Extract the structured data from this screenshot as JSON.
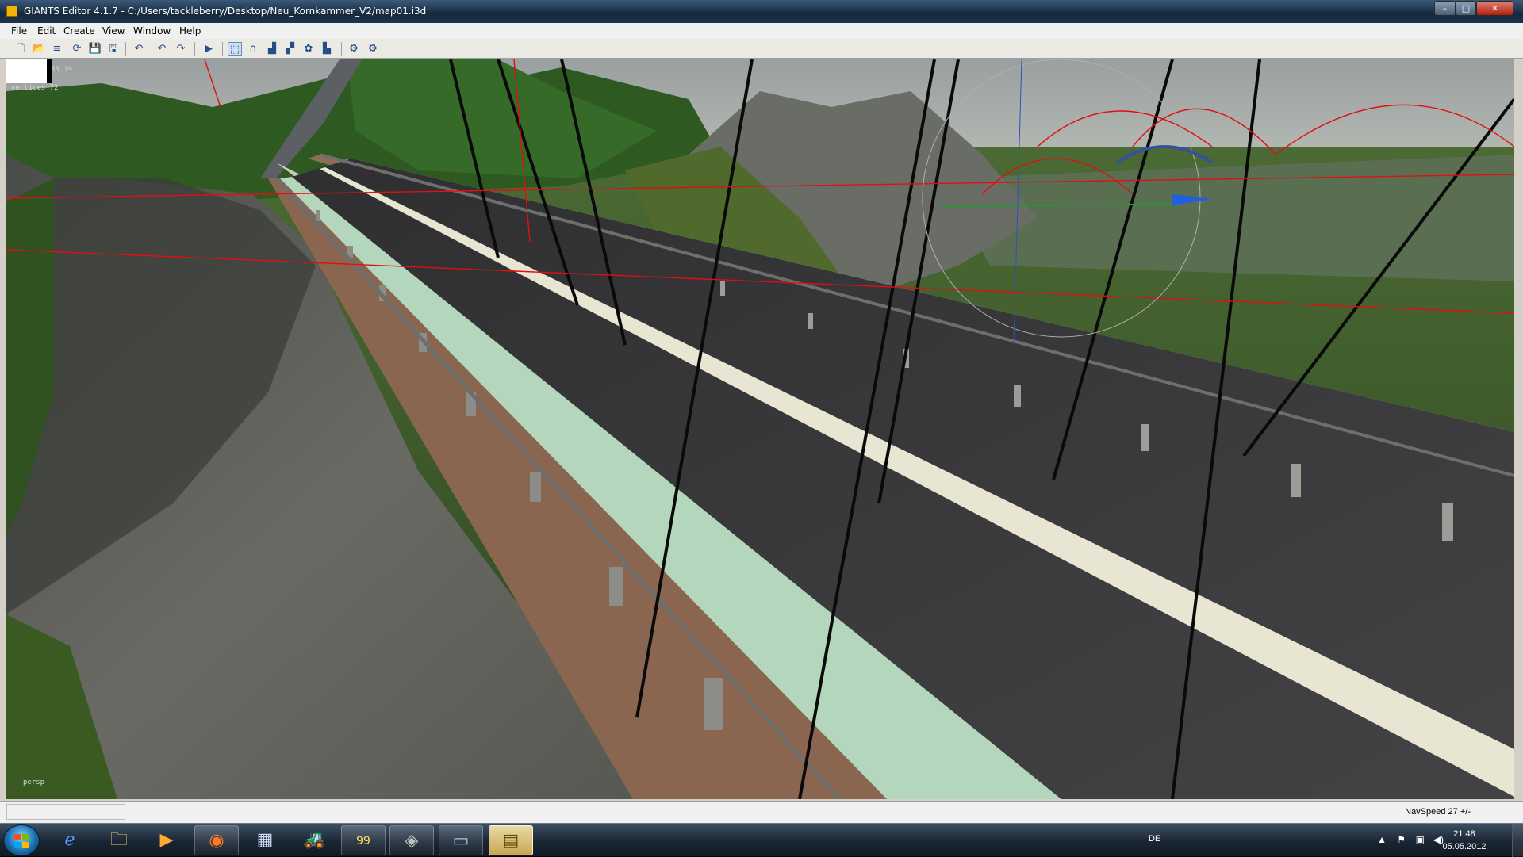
{
  "window": {
    "title": "GIANTS Editor 4.1.7 - C:/Users/tackleberry/Desktop/Neu_Kornkammer_V2/map01.i3d",
    "controls": {
      "minimize": "–",
      "maximize": "□",
      "close": "✕"
    }
  },
  "menu": {
    "items": [
      "File",
      "Edit",
      "Create",
      "View",
      "Window",
      "Help"
    ]
  },
  "toolbar": {
    "buttons": [
      {
        "icon": "new-icon",
        "glyph": "🗋"
      },
      {
        "icon": "open-icon",
        "glyph": "📂"
      },
      {
        "icon": "list-icon",
        "glyph": "≡"
      },
      {
        "icon": "reload-icon",
        "glyph": "⟳"
      },
      {
        "icon": "save-icon",
        "glyph": "💾"
      },
      {
        "icon": "save-all-icon",
        "glyph": "🖫"
      },
      {
        "icon": "undo-history-icon",
        "glyph": "↶"
      },
      {
        "icon": "undo-icon",
        "glyph": "↶"
      },
      {
        "icon": "redo-icon",
        "glyph": "↷"
      },
      {
        "icon": "play-icon",
        "glyph": "▶"
      },
      {
        "icon": "select-tool-icon",
        "glyph": "⬚"
      },
      {
        "icon": "move-tool-icon",
        "glyph": "∩"
      },
      {
        "icon": "terrain-tool-icon",
        "glyph": "▟"
      },
      {
        "icon": "terrain-paint-icon",
        "glyph": "▞"
      },
      {
        "icon": "foliage-tool-icon",
        "glyph": "✿"
      },
      {
        "icon": "detail-tool-icon",
        "glyph": "▙"
      },
      {
        "icon": "settings-icon",
        "glyph": "⚙"
      },
      {
        "icon": "settings-alt-icon",
        "glyph": "⚙"
      }
    ]
  },
  "viewport": {
    "camera_label": "persp",
    "stats_fps": "33.19",
    "stats_vertices": "vertices 72"
  },
  "statusbar": {
    "navspeed": "NavSpeed 27 +/-"
  },
  "taskbar": {
    "start_icon": "windows-start-icon",
    "apps": [
      {
        "name": "internet-explorer",
        "glyph": "ℯ"
      },
      {
        "name": "file-explorer",
        "glyph": "🗀"
      },
      {
        "name": "media-player",
        "glyph": "▶"
      },
      {
        "name": "firefox",
        "glyph": "◉"
      },
      {
        "name": "calculator",
        "glyph": "▦"
      },
      {
        "name": "tractor-game",
        "glyph": "🚜"
      },
      {
        "name": "farming-simulator-99",
        "glyph": "99"
      },
      {
        "name": "gpu-tool",
        "glyph": "◈"
      },
      {
        "name": "monitor-app",
        "glyph": "▭"
      },
      {
        "name": "giants-editor",
        "glyph": "▤"
      }
    ],
    "language": "DE",
    "time": "21:48",
    "date": "05.05.2012"
  },
  "colors": {
    "titlebar": "#1d3550",
    "selection_red": "#e01010",
    "road": "#3a3a3c",
    "bike_lane": "#b4d6bc",
    "walkway": "#8a6650"
  }
}
